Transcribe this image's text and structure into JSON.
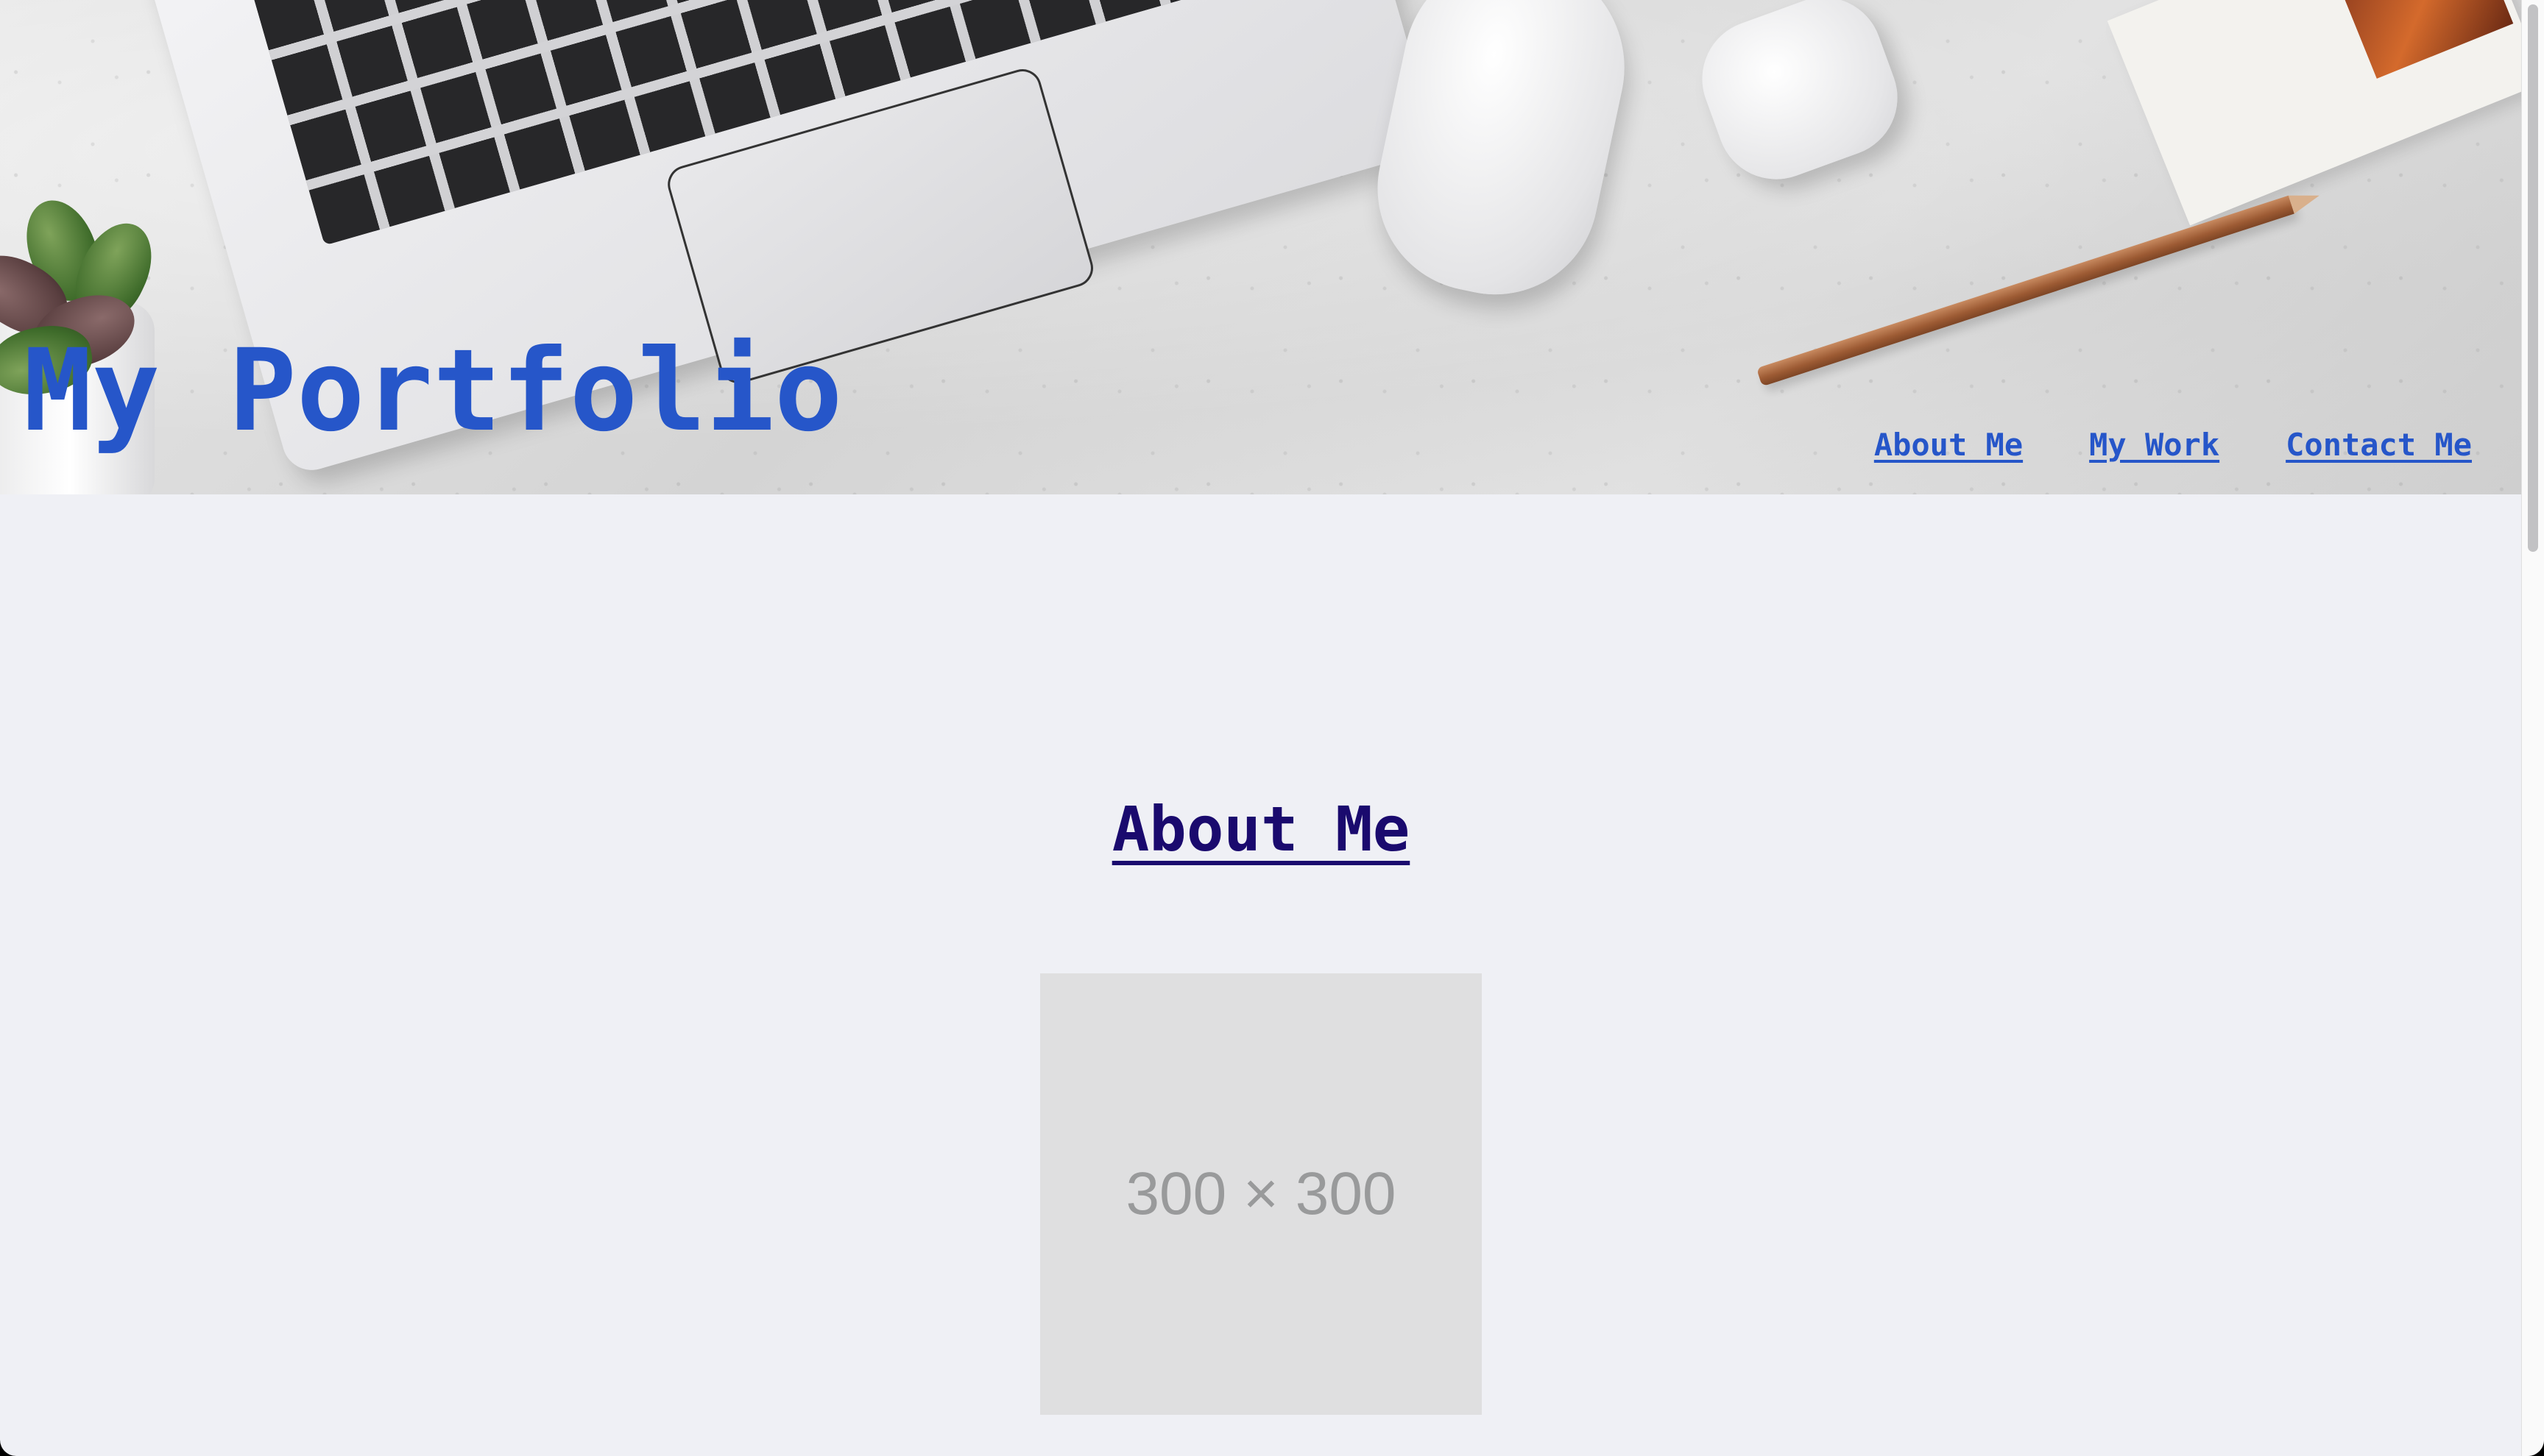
{
  "header": {
    "site_title": "My Portfolio",
    "nav": [
      {
        "label": "About Me"
      },
      {
        "label": "My Work"
      },
      {
        "label": "Contact Me"
      }
    ]
  },
  "main": {
    "about_heading": "About Me",
    "profile_image_placeholder": "300 × 300"
  },
  "colors": {
    "accent": "#2656c9",
    "heading_link": "#1a0a6e",
    "page_background": "#eff0f5",
    "placeholder_bg": "#dfdfe0",
    "placeholder_text": "#999a9b"
  }
}
